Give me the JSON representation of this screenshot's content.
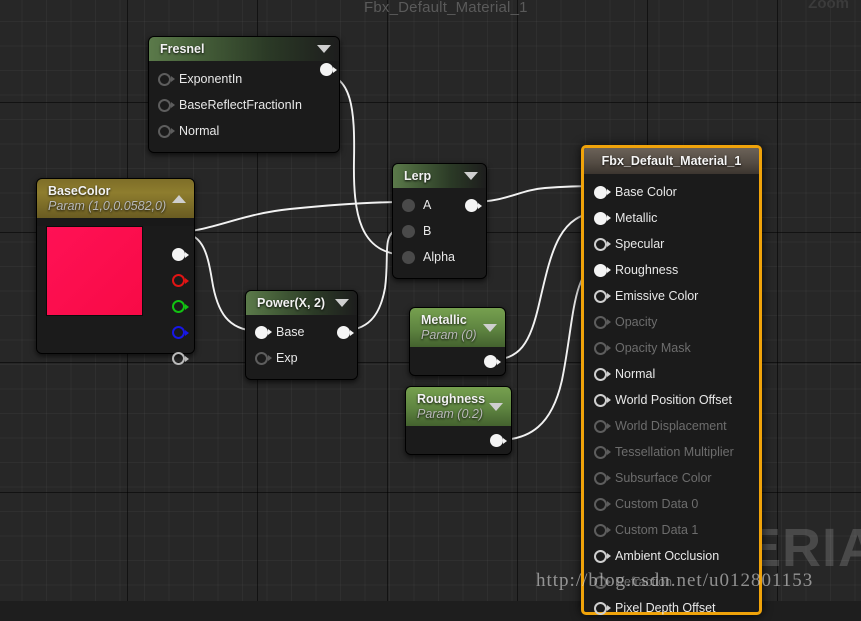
{
  "graph": {
    "title": "Fbx_Default_Material_1",
    "zoom_label": "Zoom",
    "watermark_big": "MATERIAL",
    "watermark_url": "http://blog.csdn.net/u012801153",
    "background_color": "#272727",
    "selection_color": "#f0a30a"
  },
  "nodes": {
    "fresnel": {
      "title": "Fresnel",
      "caret": "chevron-down",
      "inputs": [
        {
          "label": "ExponentIn",
          "state": "empty"
        },
        {
          "label": "BaseReflectFractionIn",
          "state": "empty"
        },
        {
          "label": "Normal",
          "state": "empty"
        }
      ],
      "outputs": [
        {
          "label": "",
          "state": "connected"
        }
      ]
    },
    "basecolor": {
      "title": "BaseColor",
      "subtitle": "Param (1,0,0.0582,0)",
      "caret": "chevron-up",
      "swatch_color": "#fa0f4b",
      "outputs": [
        {
          "label": "",
          "channel": "rgba",
          "state": "connected"
        },
        {
          "label": "",
          "channel": "r",
          "state": "empty"
        },
        {
          "label": "",
          "channel": "g",
          "state": "empty"
        },
        {
          "label": "",
          "channel": "b",
          "state": "empty"
        },
        {
          "label": "",
          "channel": "a",
          "state": "empty"
        }
      ]
    },
    "power": {
      "title": "Power(X, 2)",
      "caret": "chevron-down",
      "inputs": [
        {
          "label": "Base",
          "state": "connected"
        },
        {
          "label": "Exp",
          "state": "empty"
        }
      ],
      "outputs": [
        {
          "label": "",
          "state": "connected"
        }
      ]
    },
    "lerp": {
      "title": "Lerp",
      "caret": "chevron-down",
      "inputs": [
        {
          "label": "A",
          "state": "connected"
        },
        {
          "label": "B",
          "state": "connected"
        },
        {
          "label": "Alpha",
          "state": "connected"
        }
      ],
      "outputs": [
        {
          "label": "",
          "state": "connected"
        }
      ]
    },
    "metallic": {
      "title": "Metallic",
      "subtitle": "Param (0)",
      "caret": "chevron-down",
      "outputs": [
        {
          "label": "",
          "state": "connected"
        }
      ]
    },
    "roughness": {
      "title": "Roughness",
      "subtitle": "Param (0.2)",
      "caret": "chevron-down",
      "outputs": [
        {
          "label": "",
          "state": "connected"
        }
      ]
    },
    "material": {
      "title": "Fbx_Default_Material_1",
      "selected": true,
      "inputs": [
        {
          "label": "Base Color",
          "state": "connected",
          "enabled": true
        },
        {
          "label": "Metallic",
          "state": "connected",
          "enabled": true
        },
        {
          "label": "Specular",
          "state": "empty",
          "enabled": true
        },
        {
          "label": "Roughness",
          "state": "connected",
          "enabled": true
        },
        {
          "label": "Emissive Color",
          "state": "empty",
          "enabled": true
        },
        {
          "label": "Opacity",
          "state": "empty",
          "enabled": false
        },
        {
          "label": "Opacity Mask",
          "state": "empty",
          "enabled": false
        },
        {
          "label": "Normal",
          "state": "empty",
          "enabled": true
        },
        {
          "label": "World Position Offset",
          "state": "empty",
          "enabled": true
        },
        {
          "label": "World Displacement",
          "state": "empty",
          "enabled": false
        },
        {
          "label": "Tessellation Multiplier",
          "state": "empty",
          "enabled": false
        },
        {
          "label": "Subsurface Color",
          "state": "empty",
          "enabled": false
        },
        {
          "label": "Custom Data 0",
          "state": "empty",
          "enabled": false
        },
        {
          "label": "Custom Data 1",
          "state": "empty",
          "enabled": false
        },
        {
          "label": "Ambient Occlusion",
          "state": "empty",
          "enabled": true
        },
        {
          "label": "Refraction",
          "state": "empty",
          "enabled": false
        },
        {
          "label": "Pixel Depth Offset",
          "state": "empty",
          "enabled": true
        }
      ]
    }
  },
  "connections": [
    {
      "from": "fresnel.out",
      "to": "lerp.alpha"
    },
    {
      "from": "basecolor.rgba",
      "to": "lerp.a"
    },
    {
      "from": "basecolor.rgba",
      "to": "power.base"
    },
    {
      "from": "power.out",
      "to": "lerp.b"
    },
    {
      "from": "lerp.out",
      "to": "material.base_color"
    },
    {
      "from": "metallic.out",
      "to": "material.metallic"
    },
    {
      "from": "roughness.out",
      "to": "material.roughness"
    }
  ]
}
